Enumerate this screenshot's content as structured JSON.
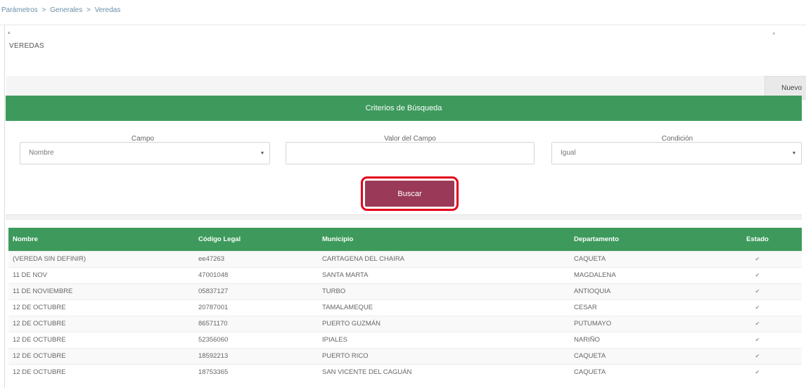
{
  "breadcrumb": {
    "items": [
      "Parámetros",
      "Generales",
      "Veredas"
    ],
    "sep": ">"
  },
  "page": {
    "title": "VEREDAS",
    "new_button": "Nuevo"
  },
  "criteria": {
    "header": "Criterios de Búsqueda",
    "field_label": "Campo",
    "field_value": "Nombre",
    "value_label": "Valor del Campo",
    "value_input": "",
    "condition_label": "Condición",
    "condition_value": "Igual",
    "search_button": "Buscar"
  },
  "table": {
    "columns": [
      "Nombre",
      "Código Legal",
      "Municipio",
      "Departamento",
      "Estado"
    ],
    "rows": [
      [
        "(VEREDA SIN DEFINIR)",
        "ee47263",
        "CARTAGENA DEL CHAIRA",
        "CAQUETA"
      ],
      [
        "11 DE NOV",
        "47001048",
        "SANTA MARTA",
        "MAGDALENA"
      ],
      [
        "11 DE NOVIEMBRE",
        "05837127",
        "TURBO",
        "ANTIOQUIA"
      ],
      [
        "12 DE OCTUBRE",
        "20787001",
        "TAMALAMEQUE",
        "CESAR"
      ],
      [
        "12 DE OCTUBRE",
        "86571170",
        "PUERTO GUZMÁN",
        "PUTUMAYO"
      ],
      [
        "12 DE OCTUBRE",
        "52356060",
        "IPIALES",
        "NARIÑO"
      ],
      [
        "12 DE OCTUBRE",
        "18592213",
        "PUERTO RICO",
        "CAQUETA"
      ],
      [
        "12 DE OCTUBRE",
        "18753365",
        "SAN VICENTE DEL CAGUÁN",
        "CAQUETA"
      ]
    ],
    "status_icon": "check-icon"
  },
  "colors": {
    "green": "#3d9a5c",
    "maroon": "#8e2944",
    "button": "#9a3a58",
    "highlight": "#e3001b"
  }
}
